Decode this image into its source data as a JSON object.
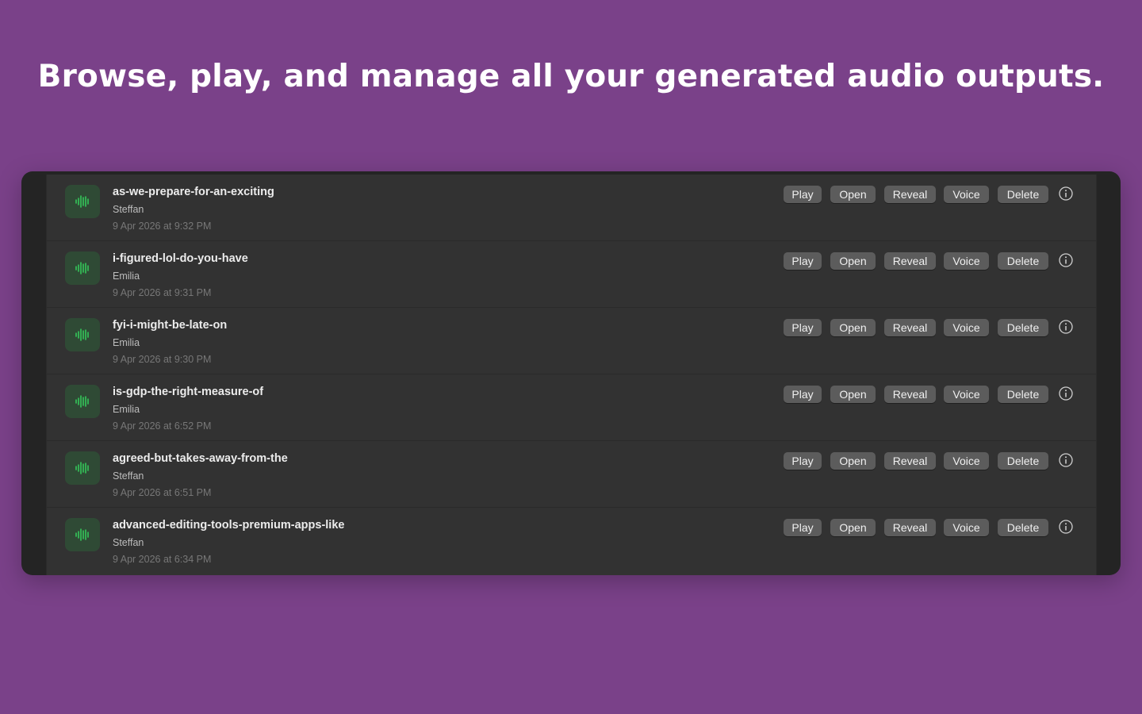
{
  "headline": "Browse, play, and manage all your generated audio outputs.",
  "colors": {
    "background": "#7a4189",
    "window": "#242424",
    "panel": "#323232",
    "accent_waveform": "#34c759",
    "button": "#5c5c5c"
  },
  "actions": {
    "play": "Play",
    "open": "Open",
    "reveal": "Reveal",
    "voice": "Voice",
    "delete": "Delete"
  },
  "items": [
    {
      "title": "as-we-prepare-for-an-exciting",
      "voice": "Steffan",
      "date": "9 Apr 2026 at 9:32 PM",
      "icon": "waveform-icon"
    },
    {
      "title": "i-figured-lol-do-you-have",
      "voice": "Emilia",
      "date": "9 Apr 2026 at 9:31 PM",
      "icon": "waveform-icon"
    },
    {
      "title": "fyi-i-might-be-late-on",
      "voice": "Emilia",
      "date": "9 Apr 2026 at 9:30 PM",
      "icon": "waveform-icon"
    },
    {
      "title": "is-gdp-the-right-measure-of",
      "voice": "Emilia",
      "date": "9 Apr 2026 at 6:52 PM",
      "icon": "waveform-icon"
    },
    {
      "title": "agreed-but-takes-away-from-the",
      "voice": "Steffan",
      "date": "9 Apr 2026 at 6:51 PM",
      "icon": "waveform-icon"
    },
    {
      "title": "advanced-editing-tools-premium-apps-like",
      "voice": "Steffan",
      "date": "9 Apr 2026 at 6:34 PM",
      "icon": "waveform-icon"
    }
  ]
}
